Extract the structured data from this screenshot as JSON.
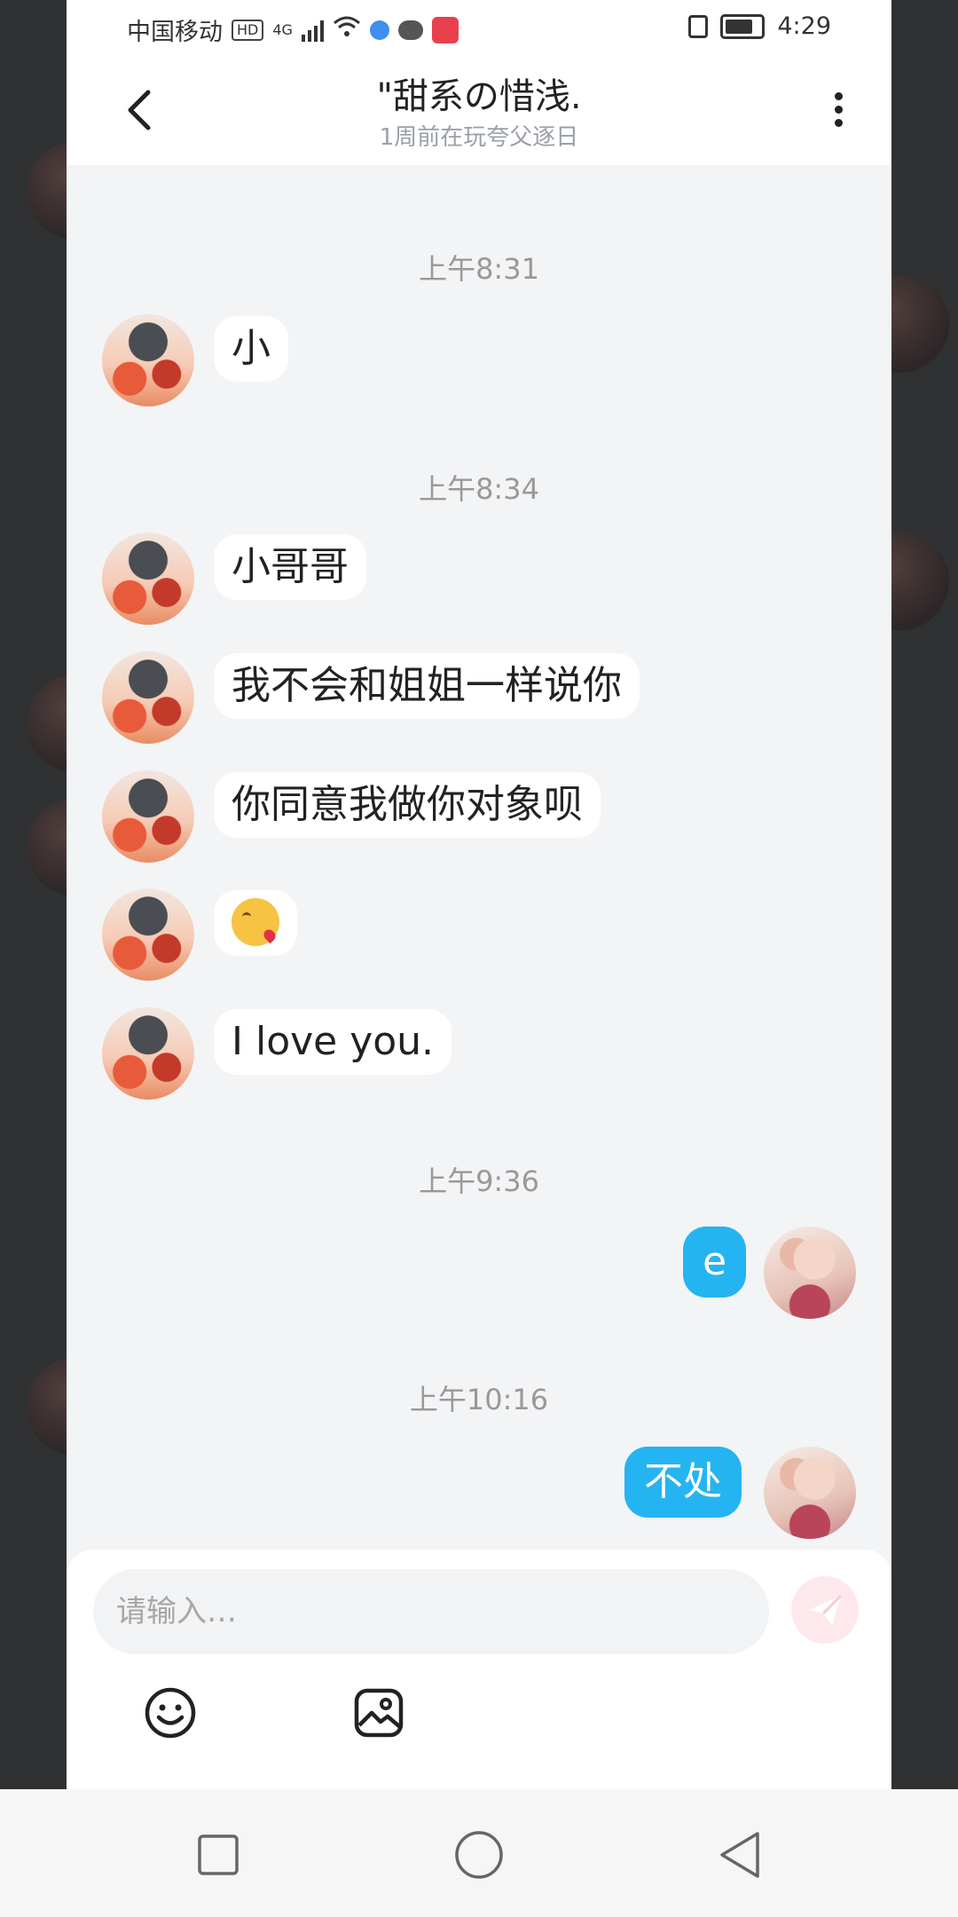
{
  "status_bar": {
    "carrier": "中国移动",
    "hd_badge": "HD",
    "network": "4G",
    "time": "4:29",
    "icons": [
      "signal-icon",
      "wifi-icon",
      "app-notification-icon",
      "wechat-icon",
      "red-app-icon",
      "vibrate-icon",
      "battery-icon"
    ]
  },
  "header": {
    "back_icon": "chevron-left-icon",
    "title": "\"甜系の惜浅.",
    "subtitle": "1周前在玩夸父逐日",
    "more_icon": "more-vertical-icon"
  },
  "messages": [
    {
      "type": "time",
      "text": "上午8:31"
    },
    {
      "type": "in",
      "text": "小"
    },
    {
      "type": "time",
      "text": "上午8:34"
    },
    {
      "type": "in",
      "text": "小哥哥"
    },
    {
      "type": "in",
      "text": "我不会和姐姐一样说你"
    },
    {
      "type": "in",
      "text": "你同意我做你对象呗"
    },
    {
      "type": "in",
      "emoji": "face-blowing-kiss-emoji"
    },
    {
      "type": "in",
      "text": "I love you."
    },
    {
      "type": "time",
      "text": "上午9:36"
    },
    {
      "type": "out",
      "text": "e"
    },
    {
      "type": "time",
      "text": "上午10:16"
    },
    {
      "type": "out",
      "text": "不处"
    }
  ],
  "composer": {
    "placeholder": "请输入…",
    "send_icon": "send-icon",
    "tools": [
      "emoji-icon",
      "image-icon"
    ]
  },
  "system_nav": {
    "buttons": [
      "recent-apps-icon",
      "home-icon",
      "back-icon"
    ]
  },
  "colors": {
    "outgoing_bubble": "#25b4f2",
    "incoming_bubble": "#ffffff",
    "chat_background": "#f3f4f6",
    "send_button": "#fde9ec"
  }
}
